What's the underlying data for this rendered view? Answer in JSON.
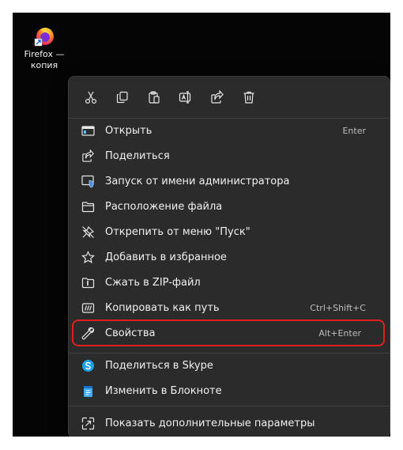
{
  "desktop": {
    "icon_label_line1": "Firefox —",
    "icon_label_line2": "копия",
    "icon": "firefox-shortcut-icon"
  },
  "toolbar": {
    "buttons": [
      {
        "name": "cut",
        "icon": "scissors-icon"
      },
      {
        "name": "copy",
        "icon": "copy-icon"
      },
      {
        "name": "paste",
        "icon": "clipboard-icon"
      },
      {
        "name": "rename",
        "icon": "rename-icon"
      },
      {
        "name": "share",
        "icon": "share-icon"
      },
      {
        "name": "delete",
        "icon": "trash-icon"
      }
    ]
  },
  "menu": {
    "items": [
      {
        "label": "Открыть",
        "shortcut": "Enter",
        "icon": "open-app-icon"
      },
      {
        "label": "Поделиться",
        "shortcut": "",
        "icon": "share-icon"
      },
      {
        "label": "Запуск от имени администратора",
        "shortcut": "",
        "icon": "shield-icon"
      },
      {
        "label": "Расположение файла",
        "shortcut": "",
        "icon": "folder-icon"
      },
      {
        "label": "Открепить от меню \"Пуск\"",
        "shortcut": "",
        "icon": "unpin-icon"
      },
      {
        "label": "Добавить в избранное",
        "shortcut": "",
        "icon": "star-icon"
      },
      {
        "label": "Сжать в ZIP-файл",
        "shortcut": "",
        "icon": "zip-folder-icon"
      },
      {
        "label": "Копировать как путь",
        "shortcut": "Ctrl+Shift+C",
        "icon": "copy-path-icon"
      },
      {
        "label": "Свойства",
        "shortcut": "Alt+Enter",
        "icon": "wrench-icon"
      }
    ],
    "extra_items": [
      {
        "label": "Поделиться в Skype",
        "icon": "skype-icon"
      },
      {
        "label": "Изменить в Блокноте",
        "icon": "notepad-icon"
      }
    ],
    "more": {
      "label": "Показать дополнительные параметры",
      "icon": "more-options-icon"
    }
  },
  "colors": {
    "menu_bg": "#2b2b2b",
    "highlight": "#e01f1f",
    "accent_blue": "#4cc2ff"
  }
}
